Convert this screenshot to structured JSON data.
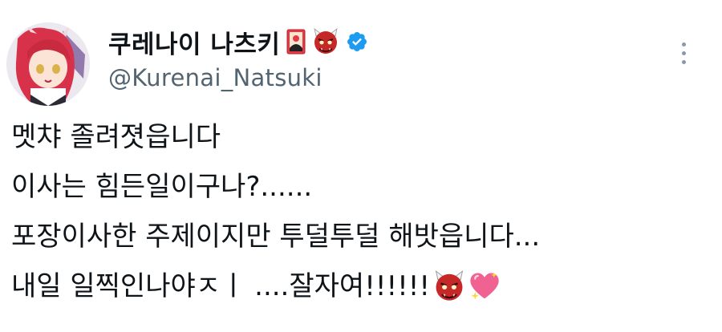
{
  "author": {
    "display_name": "쿠레나이 나츠키",
    "handle": "@Kurenai_Natsuki",
    "avatar_icon": "avatar-image",
    "name_emojis": [
      "hanafuda-card-icon",
      "ogre-icon"
    ],
    "verified_icon": "verified-badge-icon",
    "verified_color": "#1d9bf0"
  },
  "menu": {
    "more_icon": "more-vertical-icon"
  },
  "tweet": {
    "lines": [
      "멧챠 졸려졋읍니다",
      "이사는 힘든일이구나?......",
      "포장이사한 주제이지만 투덜투덜 해밧읍니다...",
      "내일 일찍인나야ㅈㅣ ....잘자여!!!!!!"
    ],
    "trailing_emojis": [
      "ogre-icon",
      "sparkling-heart-icon"
    ]
  },
  "colors": {
    "text": "#0f1419",
    "secondary_text": "#536471",
    "icon_gray": "#8b98a5"
  }
}
